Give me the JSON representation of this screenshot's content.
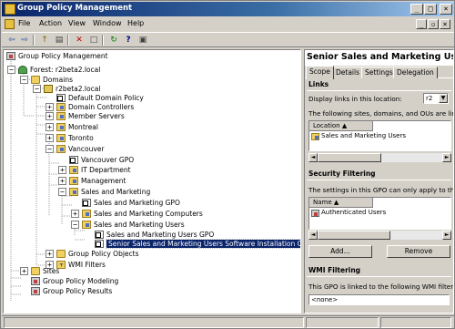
{
  "window": {
    "title": "Group Policy Management"
  },
  "menu": [
    "File",
    "Action",
    "View",
    "Window",
    "Help"
  ],
  "toolbar": {
    "buttons": [
      {
        "name": "back-button",
        "glyph": "⇦"
      },
      {
        "name": "forward-button",
        "glyph": "⇨"
      },
      {
        "name": "up-button",
        "glyph": "↑"
      },
      {
        "name": "show-hide-tree-button",
        "glyph": "▤"
      },
      {
        "name": "delete-button",
        "glyph": "✕"
      },
      {
        "name": "properties-button",
        "glyph": "□"
      },
      {
        "name": "refresh-button",
        "glyph": "↻"
      },
      {
        "name": "help-button",
        "glyph": "?"
      },
      {
        "name": "export-list-button",
        "glyph": "▣"
      }
    ]
  },
  "tree": {
    "root": "Group Policy Management",
    "forest": "Forest: r2beta2.local",
    "domains": "Domains",
    "domain": "r2beta2.local",
    "default_domain_policy": "Default Domain Policy",
    "domain_controllers": "Domain Controllers",
    "member_servers": "Member Servers",
    "montreal": "Montreal",
    "toronto": "Toronto",
    "vancouver": "Vancouver",
    "vancouver_gpo": "Vancouver GPO",
    "it_department": "IT Department",
    "management": "Management",
    "sales_marketing": "Sales and Marketing",
    "sales_marketing_gpo": "Sales and Marketing GPO",
    "sales_marketing_computers": "Sales and Marketing Computers",
    "sales_marketing_users": "Sales and Marketing Users",
    "sales_marketing_users_gpo": "Sales and Marketing Users GPO",
    "senior_gpo": "Senior Sales and Marketing Users Software Installation GPO",
    "group_policy_objects": "Group Policy Objects",
    "wmi_filters": "WMI Filters",
    "sites": "Sites",
    "modeling": "Group Policy Modeling",
    "results": "Group Policy Results"
  },
  "details": {
    "title": "Senior Sales and Marketing Users",
    "tabs": [
      "Scope",
      "Details",
      "Settings",
      "Delegation"
    ],
    "links": {
      "heading": "Links",
      "display_label": "Display links in this location:",
      "location_value": "r2",
      "description": "The following sites, domains, and OUs are lin",
      "column": "Location",
      "rows": [
        "Sales and Marketing Users"
      ]
    },
    "security": {
      "heading": "Security Filtering",
      "description": "The settings in this GPO can only apply to the",
      "column": "Name",
      "rows": [
        "Authenticated Users"
      ],
      "add_label": "Add...",
      "remove_label": "Remove"
    },
    "wmi": {
      "heading": "WMI Filtering",
      "description": "This GPO is linked to the following WMI filter:",
      "value": "<none>"
    }
  }
}
